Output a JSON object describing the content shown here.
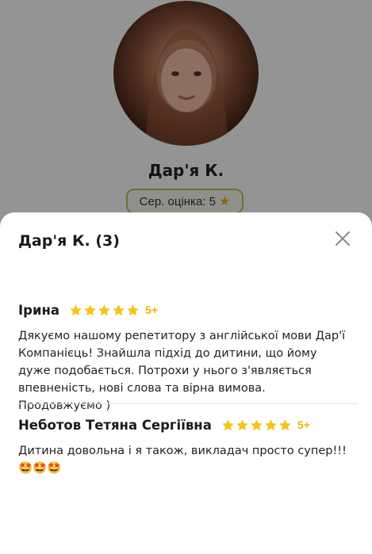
{
  "profile": {
    "name": "Дар'я К.",
    "rating_label": "Сер. оцінка: 5"
  },
  "sheet": {
    "title": "Дар'я К. (3)"
  },
  "reviews": [
    {
      "name": "Ірина",
      "stars": 5,
      "grade": "5+",
      "text": "Дякуємо нашому репетитору з англійської мови Дар'ї Компанієць! Знайшла підхід до дитини, що йому дуже подобається. Потрохи у нього з'являється впевненість, нові слова та вірна вимова. Продовжуємо )"
    },
    {
      "name": "Неботов Тетяна Сергіївна",
      "stars": 5,
      "grade": "5+",
      "text": "Дитина довольна і я також, викладач просто супер!!!🤩🤩🤩"
    }
  ],
  "colors": {
    "star": "#f5c518",
    "accent": "#a9cc5d"
  }
}
